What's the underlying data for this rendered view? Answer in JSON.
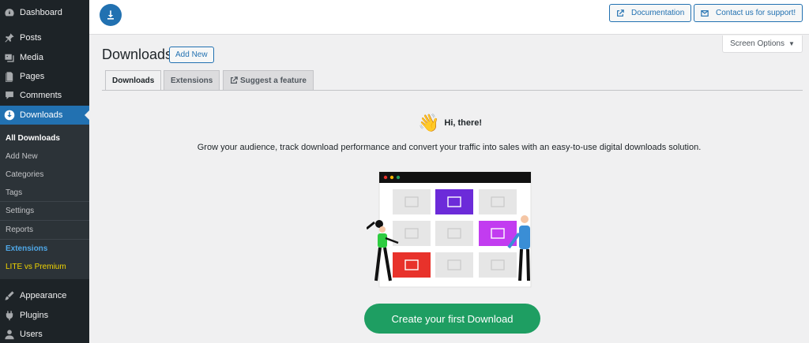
{
  "sidebar": {
    "items": [
      {
        "label": "Dashboard",
        "icon": "dashboard-icon"
      },
      {
        "label": "Posts",
        "icon": "pin-icon"
      },
      {
        "label": "Media",
        "icon": "media-icon"
      },
      {
        "label": "Pages",
        "icon": "pages-icon"
      },
      {
        "label": "Comments",
        "icon": "comments-icon"
      },
      {
        "label": "Downloads",
        "icon": "download-icon",
        "active": true
      },
      {
        "label": "Appearance",
        "icon": "brush-icon"
      },
      {
        "label": "Plugins",
        "icon": "plugin-icon"
      },
      {
        "label": "Users",
        "icon": "users-icon"
      }
    ],
    "submenu": [
      {
        "label": "All Downloads",
        "current": true
      },
      {
        "label": "Add New"
      },
      {
        "label": "Categories"
      },
      {
        "label": "Tags"
      },
      {
        "label": "Settings"
      },
      {
        "label": "Reports"
      },
      {
        "label": "Extensions"
      },
      {
        "label": "LITE vs Premium"
      }
    ]
  },
  "topbar": {
    "documentation_label": "Documentation",
    "support_label": "Contact us for support!"
  },
  "screen_options": {
    "label": "Screen Options",
    "arrow": "▼"
  },
  "page": {
    "title": "Downloads",
    "add_new_label": "Add New"
  },
  "tabs": [
    {
      "label": "Downloads",
      "active": true
    },
    {
      "label": "Extensions"
    },
    {
      "label": "Suggest a feature",
      "icon": "external-link-icon"
    }
  ],
  "welcome": {
    "greeting": "Hi, there!",
    "wave": "👋",
    "description": "Grow your audience, track download performance and convert your traffic into sales with an easy-to-use digital downloads solution.",
    "cta_label": "Create your first Download"
  },
  "colors": {
    "sidebar_bg": "#1d2327",
    "accent": "#2271b1",
    "cta": "#1e9e62",
    "purple": "#6c2bd9",
    "magenta": "#c23cf0",
    "red": "#e8322b"
  }
}
